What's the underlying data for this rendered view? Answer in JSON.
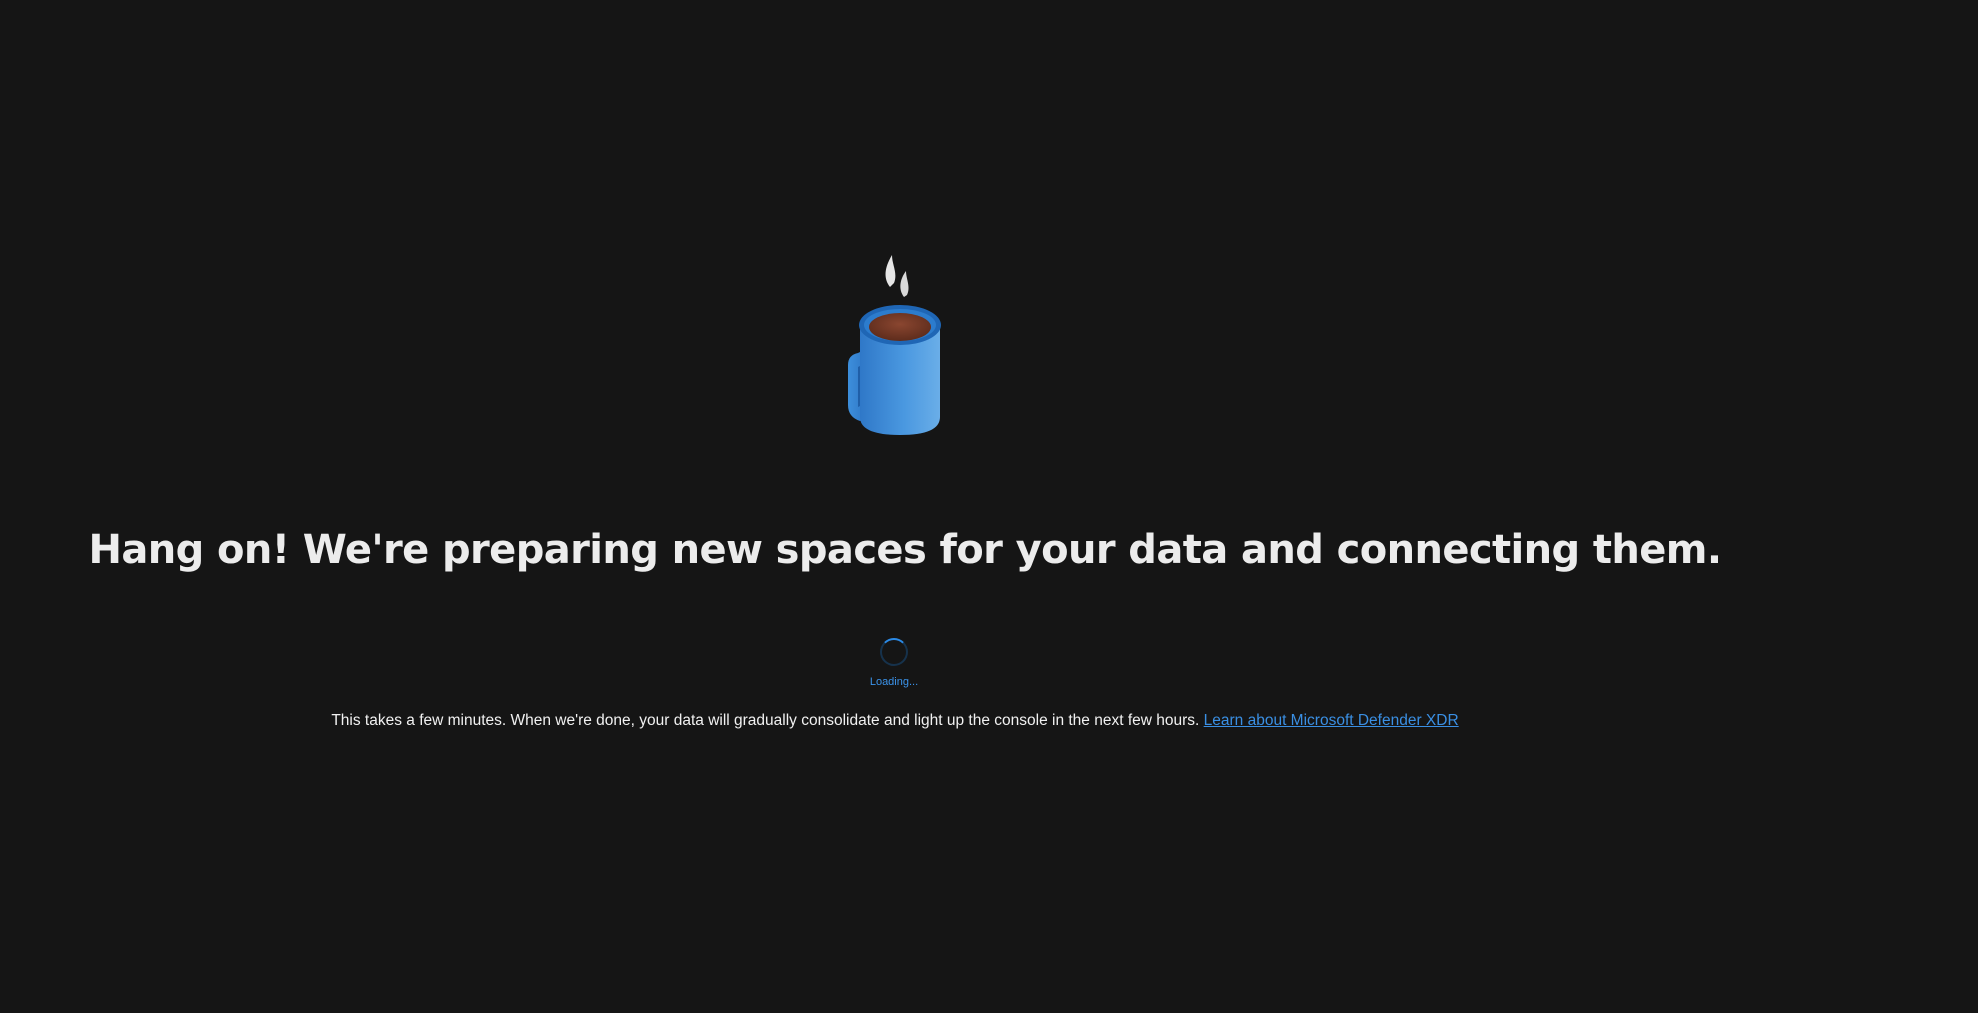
{
  "main": {
    "title": "Hang on! We're preparing new spaces for your data and connecting them.",
    "loading_label": "Loading...",
    "description": "This takes a few minutes. When we're done, your data will gradually consolidate and light up the console in the next few hours.",
    "learn_link": "Learn about Microsoft Defender XDR"
  },
  "illustration": {
    "icon": "coffee-mug-icon",
    "mug_color": "#3f8fd8",
    "coffee_color": "#7a3c26",
    "steam_color": "#e6e6e6"
  },
  "colors": {
    "background": "#151515",
    "accent": "#3a8fe3",
    "text": "#ececec"
  }
}
